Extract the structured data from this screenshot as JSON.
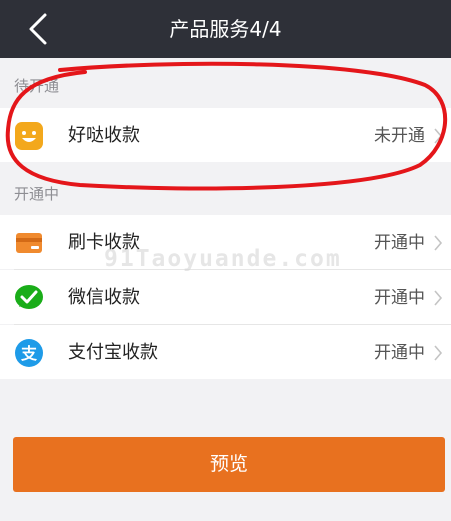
{
  "header": {
    "title": "产品服务4/4"
  },
  "sections": {
    "not_open": {
      "label": "待开通"
    },
    "open": {
      "label": "开通中"
    }
  },
  "services": [
    {
      "label": "好哒收款",
      "status": "未开通",
      "icon": "haoda-face-icon"
    },
    {
      "label": "刷卡收款",
      "status": "开通中",
      "icon": "card-icon"
    },
    {
      "label": "微信收款",
      "status": "开通中",
      "icon": "wechat-check-icon"
    },
    {
      "label": "支付宝收款",
      "status": "开通中",
      "icon": "alipay-icon"
    }
  ],
  "watermark": "91Taoyuande.com",
  "preview_button": {
    "label": "预览"
  },
  "colors": {
    "nav_bg": "#2e3038",
    "accent_orange": "#e8711f",
    "annotation_red": "#e4161a",
    "background": "#f2f2f4"
  }
}
